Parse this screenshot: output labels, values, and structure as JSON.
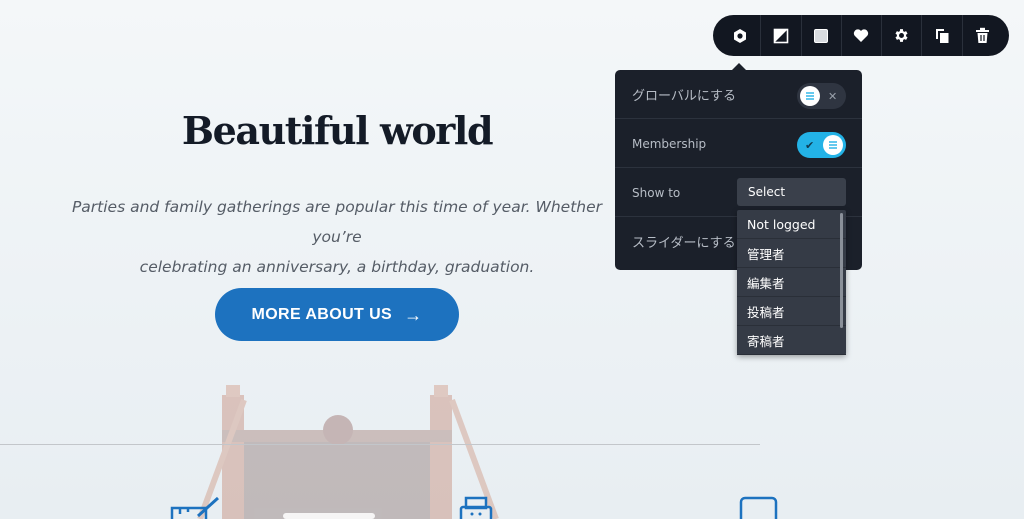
{
  "hero": {
    "title": "Beautiful world",
    "text_line1": "Parties and family gatherings are popular this time of year. Whether you’re",
    "text_line2": "celebrating an anniversary, a birthday, graduation.",
    "button_label": "MORE ABOUT US",
    "button_color": "#1d72bf"
  },
  "toolbar": {
    "icons": [
      "settings-hex-icon",
      "contrast-icon",
      "square-icon",
      "heart-icon",
      "gear-icon",
      "duplicate-icon",
      "trash-icon"
    ]
  },
  "panel": {
    "global_label": "グローバルにする",
    "global_on": false,
    "membership_label": "Membership",
    "membership_on": true,
    "show_to_label": "Show to",
    "select_value": "Select",
    "slider_label": "スライダーにする",
    "accent_color": "#23b2e6"
  },
  "dropdown": {
    "options": [
      "Not logged",
      "管理者",
      "編集者",
      "投稿者",
      "寄稿者"
    ]
  }
}
